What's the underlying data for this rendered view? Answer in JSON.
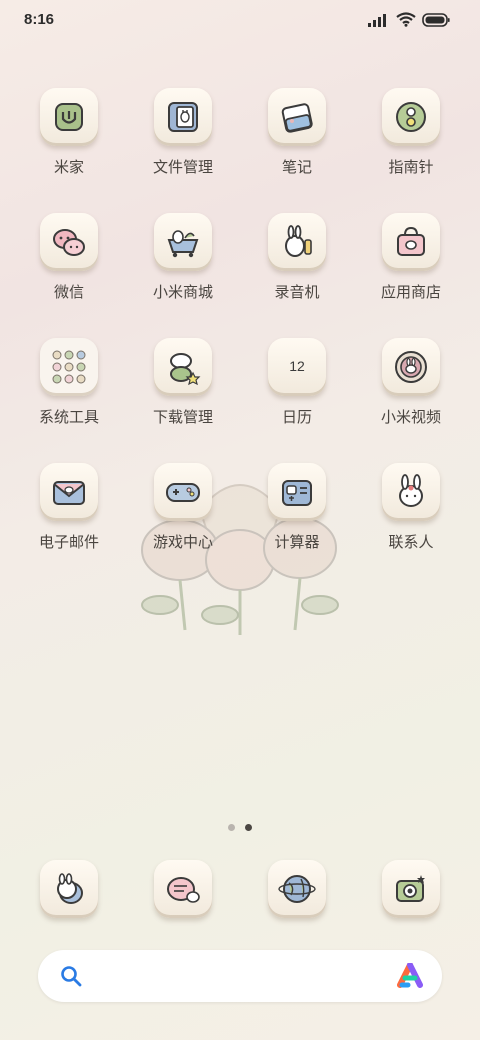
{
  "status_bar": {
    "time": "8:16",
    "signal_icon": "signal-icon",
    "wifi_icon": "wifi-icon",
    "battery_icon": "battery-icon"
  },
  "apps": [
    {
      "label": "米家",
      "icon": "mijia-icon"
    },
    {
      "label": "文件管理",
      "icon": "file-manager-icon"
    },
    {
      "label": "笔记",
      "icon": "notes-icon"
    },
    {
      "label": "指南针",
      "icon": "compass-icon"
    },
    {
      "label": "微信",
      "icon": "wechat-icon"
    },
    {
      "label": "小米商城",
      "icon": "mi-store-icon"
    },
    {
      "label": "录音机",
      "icon": "recorder-icon"
    },
    {
      "label": "应用商店",
      "icon": "app-store-icon"
    },
    {
      "label": "系统工具",
      "icon": "system-tools-folder-icon"
    },
    {
      "label": "下载管理",
      "icon": "downloads-icon"
    },
    {
      "label": "日历",
      "icon": "calendar-icon",
      "badge": "12"
    },
    {
      "label": "小米视频",
      "icon": "mi-video-icon"
    },
    {
      "label": "电子邮件",
      "icon": "email-icon"
    },
    {
      "label": "游戏中心",
      "icon": "game-center-icon"
    },
    {
      "label": "计算器",
      "icon": "calculator-icon"
    },
    {
      "label": "联系人",
      "icon": "contacts-icon"
    }
  ],
  "page_indicator": {
    "pages": 2,
    "active": 2
  },
  "dock": [
    {
      "icon": "phone-bunny-icon"
    },
    {
      "icon": "messages-bunny-icon"
    },
    {
      "icon": "browser-globe-icon"
    },
    {
      "icon": "camera-icon"
    }
  ],
  "search_bar": {
    "search_icon": "search-icon",
    "assistant_icon": "assistant-logo-icon"
  },
  "colors": {
    "background": "#f3ece6",
    "tile": "#f8f2e8",
    "label_text": "#4a4540",
    "outline": "#3b3b3b"
  }
}
